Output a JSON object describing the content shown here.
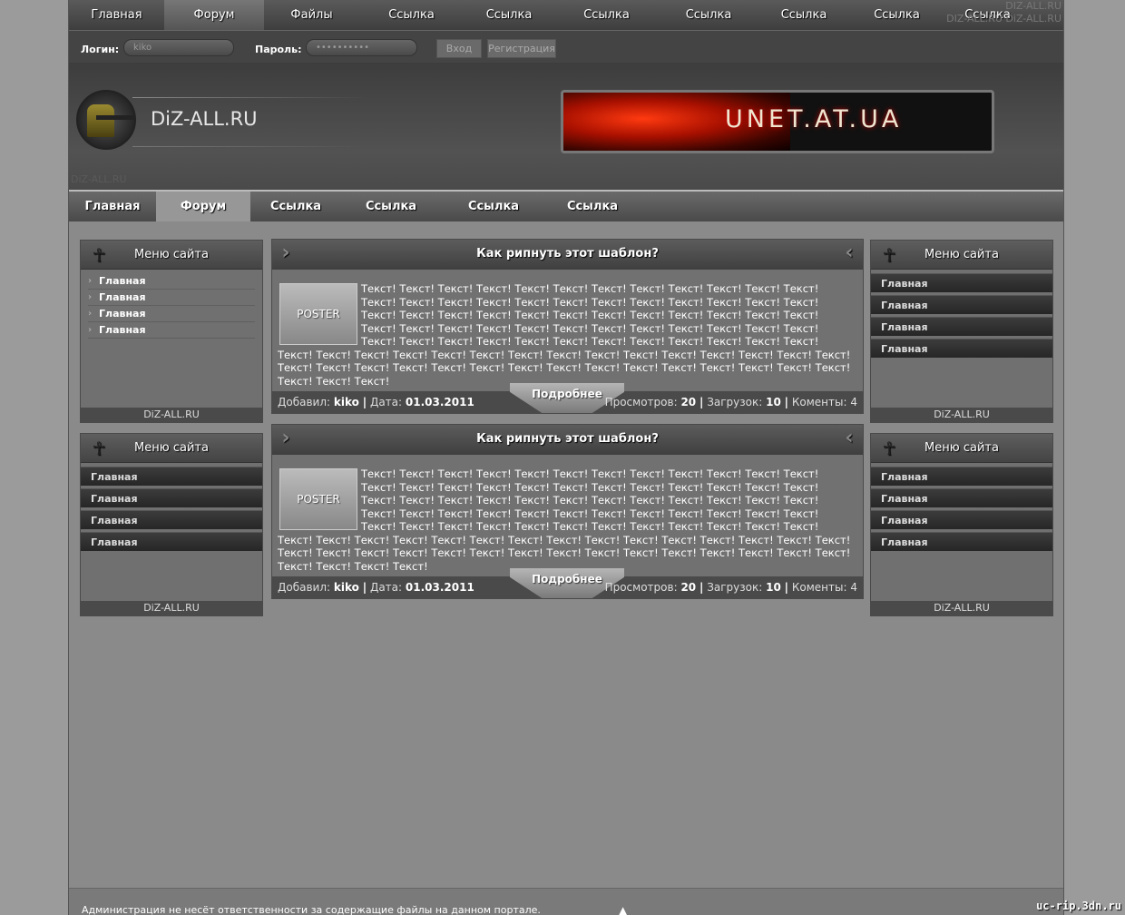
{
  "top_nav": {
    "items": [
      "Главная",
      "Форум",
      "Файлы",
      "Ссылка",
      "Ссылка",
      "Ссылка",
      "Ссылка",
      "Ссылка",
      "Ссылка",
      "Ссылка"
    ],
    "active_index": 1,
    "watermark_line1": "DIZ-ALL.RU",
    "watermark_line2": "DIZ-ALL.RU DiZ-ALL.RU"
  },
  "login": {
    "login_label": "Логин:",
    "login_value": "kiko",
    "password_label": "Пароль:",
    "password_value": "••••••••••",
    "enter_button": "Вход",
    "register_button": "Регистрация"
  },
  "header": {
    "logo_text": "DiZ-ALL.RU",
    "logo_small": "DiZ-ALL.RU",
    "banner_text": "UNET.AT.UA"
  },
  "menu2": {
    "items": [
      "Главная",
      "Форум",
      "Ссылка",
      "Ссылка",
      "Ссылка",
      "Ссылка"
    ],
    "active_index": 1
  },
  "left_blocks": [
    {
      "title": "Меню сайта",
      "items": [
        "Главная",
        "Главная",
        "Главная",
        "Главная"
      ],
      "footer": "DiZ-ALL.RU",
      "style": "list"
    },
    {
      "title": "Меню сайта",
      "items": [
        "Главная",
        "Главная",
        "Главная",
        "Главная"
      ],
      "footer": "DiZ-ALL.RU",
      "style": "bars"
    }
  ],
  "right_blocks": [
    {
      "title": "Меню сайта",
      "items": [
        "Главная",
        "Главная",
        "Главная",
        "Главная"
      ],
      "footer": "DiZ-ALL.RU"
    },
    {
      "title": "Меню сайта",
      "items": [
        "Главная",
        "Главная",
        "Главная",
        "Главная"
      ],
      "footer": "DiZ-ALL.RU"
    }
  ],
  "posts": [
    {
      "title": "Как рипнуть этот шаблон?",
      "poster": "POSTER",
      "text": "Текст! Текст! Текст! Текст! Текст! Текст! Текст! Текст! Текст! Текст! Текст! Текст! Текст! Текст! Текст! Текст! Текст! Текст! Текст! Текст! Текст! Текст! Текст! Текст! Текст! Текст! Текст! Текст! Текст! Текст! Текст! Текст! Текст! Текст! Текст! Текст! Текст! Текст! Текст! Текст! Текст! Текст! Текст! Текст! Текст! Текст! Текст! Текст! Текст! Текст! Текст! Текст! Текст! Текст! Текст! Текст! Текст! Текст! Текст! Текст! Текст! Текст! Текст! Текст! Текст! Текст! Текст! Текст! Текст! Текст! Текст! Текст! Текст! Текст! Текст! Текст! Текст! Текст! Текст! Текст! Текст! Текст! Текст! Текст! Текст! Текст! Текст! Текст! Текст! Текст! Текст! Текст! Текст!",
      "added_label": "Добавил:",
      "author": "kiko",
      "date_label": "Дата:",
      "date": "01.03.2011",
      "more": "Подробнее",
      "views_label": "Просмотров:",
      "views": "20",
      "downloads_label": "Загрузок:",
      "downloads": "10",
      "comments_label": "Коменты:",
      "comments": "4"
    },
    {
      "title": "Как рипнуть этот шаблон?",
      "poster": "POSTER",
      "text": "Текст! Текст! Текст! Текст! Текст! Текст! Текст! Текст! Текст! Текст! Текст! Текст! Текст! Текст! Текст! Текст! Текст! Текст! Текст! Текст! Текст! Текст! Текст! Текст! Текст! Текст! Текст! Текст! Текст! Текст! Текст! Текст! Текст! Текст! Текст! Текст! Текст! Текст! Текст! Текст! Текст! Текст! Текст! Текст! Текст! Текст! Текст! Текст! Текст! Текст! Текст! Текст! Текст! Текст! Текст! Текст! Текст! Текст! Текст! Текст! Текст! Текст! Текст! Текст! Текст! Текст! Текст! Текст! Текст! Текст! Текст! Текст! Текст! Текст! Текст! Текст! Текст! Текст! Текст! Текст! Текст! Текст! Текст! Текст! Текст! Текст! Текст! Текст! Текст! Текст! Текст! Текст! Текст! Текст!",
      "added_label": "Добавил:",
      "author": "kiko",
      "date_label": "Дата:",
      "date": "01.03.2011",
      "more": "Подробнее",
      "views_label": "Просмотров:",
      "views": "20",
      "downloads_label": "Загрузок:",
      "downloads": "10",
      "comments_label": "Коменты:",
      "comments": "4"
    }
  ],
  "footer": {
    "disclaimer": "Администрация не несёт ответственности за содержащие файлы на данном портале.",
    "up_arrow": "▲"
  },
  "corner_watermark": "uc-rip.3dn.ru"
}
